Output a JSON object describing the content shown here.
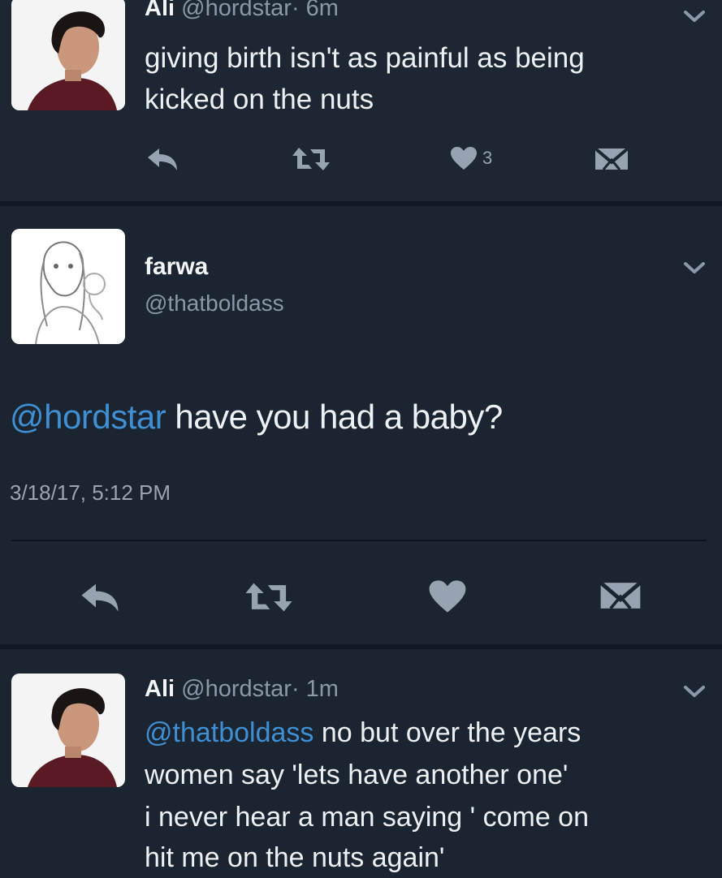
{
  "tweet1": {
    "name": "Ali",
    "handle": "@hordstar",
    "time": "· 6m",
    "text_line1": "giving birth isn't as painful as being",
    "text_line2": "kicked on the nuts",
    "likes": "3",
    "icons": [
      "reply-icon",
      "retweet-icon",
      "heart-icon",
      "direct-message-icon",
      "chevron-down-icon"
    ]
  },
  "tweet2": {
    "name": "farwa",
    "handle": "@thatboldass",
    "mention": "@hordstar",
    "text": " have you had a baby?",
    "timestamp": "3/18/17, 5:12 PM",
    "icons": [
      "reply-icon",
      "retweet-icon",
      "heart-icon",
      "direct-message-icon",
      "chevron-down-icon"
    ]
  },
  "tweet3": {
    "name": "Ali",
    "handle": "@hordstar",
    "time": "· 1m",
    "mention": "@thatboldass",
    "text_line1_rest": " no but over the years",
    "text_line2": "women say 'lets have another one'",
    "text_line3": "i never hear a man saying ' come on",
    "text_line4": "hit me on the nuts again'",
    "icons": [
      "chevron-down-icon"
    ]
  },
  "colors": {
    "background": "#1b2431",
    "mention": "#3f8fd2",
    "handle": "#8b98a7",
    "icon": "#97a3b0"
  }
}
